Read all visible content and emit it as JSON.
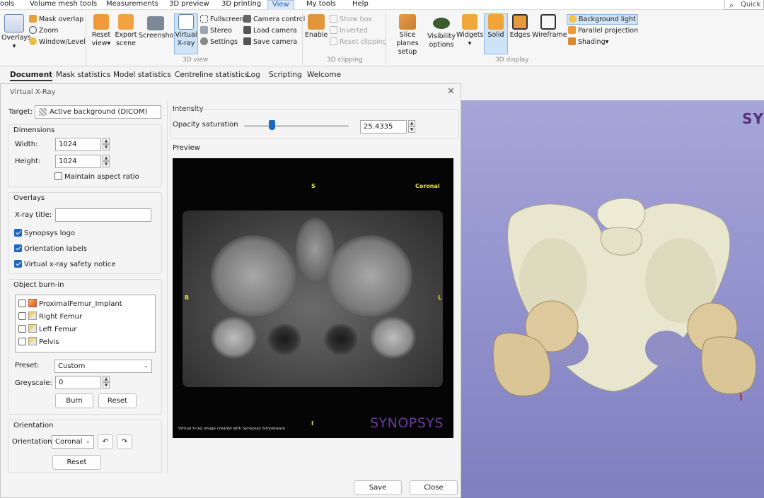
{
  "menubar": {
    "items": [
      "ools",
      "Volume mesh tools",
      "Measurements",
      "3D preview",
      "3D printing",
      "View",
      "My tools",
      "Help"
    ],
    "active": "View",
    "quick_search": "Quick"
  },
  "ribbon": {
    "overlays": {
      "label": "Overlays",
      "arrow": "▾"
    },
    "mask_overlap": "Mask overlap",
    "zoom": "Zoom",
    "window_level": "Window/Level",
    "reset_view": "Reset view▾",
    "export_scene": "Export scene",
    "screenshot": "Screenshot",
    "virtual_xray": "Virtual X-ray",
    "fullscreen": "Fullscreen",
    "stereo": "Stereo",
    "settings": "Settings",
    "camera_control": "Camera control",
    "load_camera": "Load camera",
    "save_camera": "Save camera",
    "group_3d_view": "3D view",
    "enable": "Enable",
    "show_box": "Show box",
    "inverted": "Inverted",
    "reset_clipping": "Reset clipping",
    "group_3d_clipping": "3D clipping",
    "slice_planes_setup": "Slice planes setup",
    "visibility_options": "Visibility options",
    "widgets": "Widgets",
    "widgets_arrow": "▾",
    "solid": "Solid",
    "edges": "Edges",
    "wireframe": "Wireframe",
    "background_light": "Background light",
    "parallel_projection": "Parallel projection",
    "shading": "Shading▾",
    "group_3d_display": "3D display"
  },
  "doc_tabs": [
    "Document",
    "Mask statistics",
    "Model statistics",
    "Centreline statistics",
    "Log",
    "Scripting",
    "Welcome"
  ],
  "dialog": {
    "title": "Virtual X-Ray",
    "target_label": "Target:",
    "target_value": "Active background (DICOM)",
    "dimensions": {
      "header": "Dimensions",
      "width_label": "Width:",
      "width_value": "1024",
      "height_label": "Height:",
      "height_value": "1024",
      "maintain_aspect": "Maintain aspect ratio"
    },
    "overlays": {
      "header": "Overlays",
      "xray_title_label": "X-ray title:",
      "xray_title_value": "",
      "synopsys_logo": "Synopsys logo",
      "orientation_labels": "Orientation labels",
      "safety_notice": "Virtual x-ray safety notice"
    },
    "burn_in": {
      "header": "Object burn-in",
      "objects": [
        "ProximalFemur_Implant",
        "Right Femur",
        "Left Femur",
        "Pelvis"
      ],
      "preset_label": "Preset:",
      "preset_value": "Custom",
      "greyscale_label": "Greyscale:",
      "greyscale_value": "0",
      "burn_button": "Burn",
      "reset_button": "Reset"
    },
    "orientation": {
      "header": "Orientation",
      "label": "Orientation",
      "value": "Coronal",
      "rotate_left": "↶",
      "rotate_right": "↷",
      "reset_button": "Reset"
    },
    "intensity": {
      "header": "Intensity",
      "opacity_label": "Opacity saturation",
      "opacity_value": "25.4335"
    },
    "preview": {
      "header": "Preview",
      "label_top": "S",
      "label_bottom": "I",
      "label_left": "R",
      "label_right": "L",
      "label_view": "Coronal",
      "notice": "Virtual X-ray image created with Synopsys Simpleware",
      "logo": "SYNOPSYS"
    },
    "save_button": "Save",
    "close_button": "Close"
  },
  "viewport": {
    "logo": "SY"
  }
}
